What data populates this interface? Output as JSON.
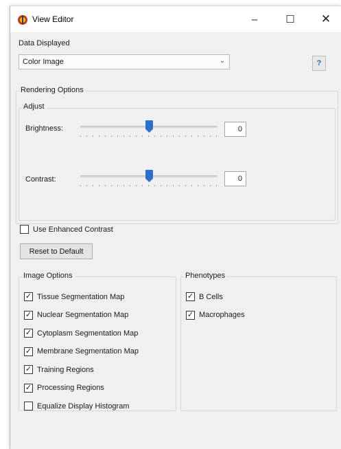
{
  "window": {
    "title": "View Editor",
    "minimize_glyph": "–",
    "maximize_glyph": "☐",
    "close_glyph": "✕"
  },
  "data_displayed": {
    "label": "Data Displayed",
    "selected": "Color Image",
    "help_label": "?"
  },
  "rendering": {
    "group_label": "Rendering Options",
    "adjust_label": "Adjust",
    "brightness": {
      "label": "Brightness:",
      "value": "0",
      "level": 0.5
    },
    "contrast": {
      "label": "Contrast:",
      "value": "0",
      "level": 0.5
    },
    "enhanced_contrast": {
      "label": "Use Enhanced Contrast",
      "checked": false
    },
    "reset_label": "Reset to Default"
  },
  "image_options": {
    "label": "Image Options",
    "items": [
      {
        "label": "Tissue Segmentation Map",
        "checked": true
      },
      {
        "label": "Nuclear Segmentation Map",
        "checked": true
      },
      {
        "label": "Cytoplasm Segmentation Map",
        "checked": true
      },
      {
        "label": "Membrane Segmentation Map",
        "checked": true
      },
      {
        "label": "Training Regions",
        "checked": true
      },
      {
        "label": "Processing Regions",
        "checked": true
      },
      {
        "label": "Equalize Display Histogram",
        "checked": false
      }
    ]
  },
  "phenotypes": {
    "label": "Phenotypes",
    "items": [
      {
        "label": "B Cells",
        "checked": true
      },
      {
        "label": "Macrophages",
        "checked": true
      }
    ]
  },
  "colors": {
    "accent": "#2b6fc8",
    "app_icon_primary": "#c0392b",
    "app_icon_secondary": "#f1c40f"
  }
}
